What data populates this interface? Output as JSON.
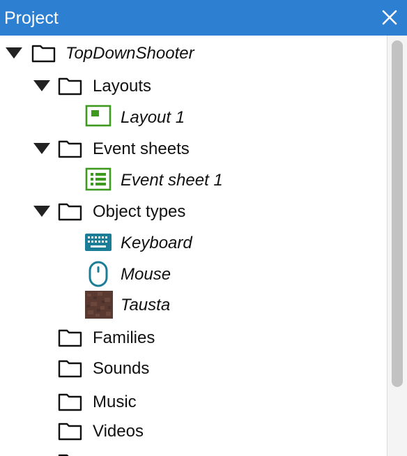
{
  "panel": {
    "title": "Project",
    "close_icon": "close-icon"
  },
  "tree": {
    "root": {
      "label": "TopDownShooter",
      "expanded": true,
      "icon": "folder-icon"
    },
    "items": [
      {
        "label": "Layouts",
        "expanded": true,
        "icon": "folder-icon"
      },
      {
        "label": "Layout 1",
        "icon": "layout-icon",
        "color": "#3e9a1e"
      },
      {
        "label": "Event sheets",
        "expanded": true,
        "icon": "folder-icon"
      },
      {
        "label": "Event sheet 1",
        "icon": "event-sheet-icon",
        "color": "#3e9a1e"
      },
      {
        "label": "Object types",
        "expanded": true,
        "icon": "folder-icon"
      },
      {
        "label": "Keyboard",
        "icon": "keyboard-icon",
        "color": "#1b7e96"
      },
      {
        "label": "Mouse",
        "icon": "mouse-icon",
        "color": "#1b7e96"
      },
      {
        "label": "Tausta",
        "icon": "tausta-thumbnail-icon",
        "color": "#5a3a30"
      },
      {
        "label": "Families",
        "icon": "folder-icon"
      },
      {
        "label": "Sounds",
        "icon": "folder-icon"
      },
      {
        "label": "Music",
        "icon": "folder-icon"
      },
      {
        "label": "Videos",
        "icon": "folder-icon"
      }
    ]
  },
  "colors": {
    "title_bar": "#2d7fd2",
    "green": "#3e9a1e",
    "teal": "#1b7e96"
  }
}
